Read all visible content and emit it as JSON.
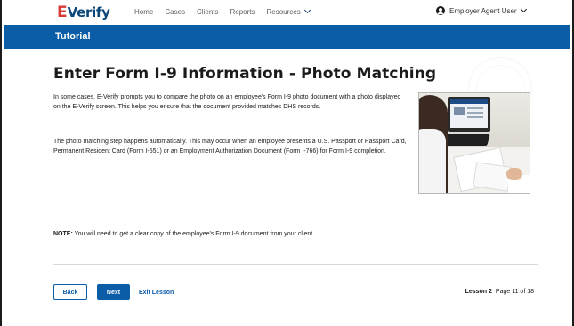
{
  "nav": {
    "logo_mark": "E",
    "logo_text": "Verify",
    "links": [
      "Home",
      "Cases",
      "Clients",
      "Reports",
      "Resources"
    ],
    "user_label": "Employer Agent User"
  },
  "banner": {
    "title": "Tutorial"
  },
  "content": {
    "heading": "Enter Form I-9 Information - Photo Matching",
    "paragraph1": "In some cases, E-Verify prompts you to compare the photo on an employee's Form I-9 photo document with a photo displayed on the E-Verify screen. This helps you ensure that the document provided matches DHS records.",
    "paragraph2": "The photo matching step happens automatically. This may occur when an employee presents a U.S. Passport or Passport Card, Permanent Resident Card (Form I-551) or an Employment Authorization Document (Form I-766) for Form I-9 completion.",
    "note_label": "NOTE:",
    "note_text": " You will need to get a clear copy of the employee's Form I-9 document from your client."
  },
  "footer": {
    "back_label": "Back",
    "next_label": "Next",
    "exit_label": "Exit Lesson",
    "lesson_label": "Lesson 2",
    "page_label": "Page 11 of 18"
  },
  "colors": {
    "brand_blue": "#0b5da7",
    "logo_red": "#d83933",
    "logo_navy": "#0b4778"
  }
}
